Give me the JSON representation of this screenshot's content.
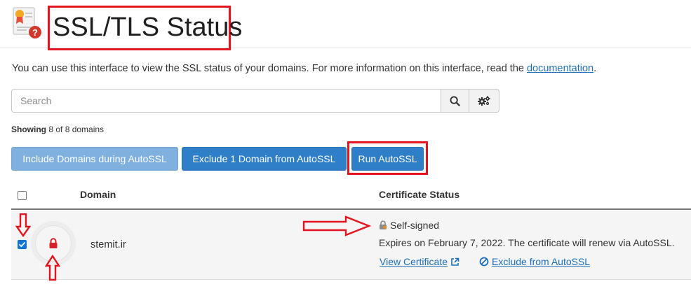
{
  "header": {
    "title": "SSL/TLS Status",
    "icon": "ssl-certificate-icon"
  },
  "intro": {
    "text": "You can use this interface to view the SSL status of your domains. For more information on this interface, read the ",
    "link": "documentation",
    "suffix": "."
  },
  "search": {
    "placeholder": "Search",
    "value": ""
  },
  "showing": {
    "label": "Showing",
    "text": "8 of 8 domains"
  },
  "actions": {
    "include": "Include Domains during AutoSSL",
    "exclude": "Exclude 1 Domain from AutoSSL",
    "run": "Run AutoSSL"
  },
  "table": {
    "columns": [
      "Domain",
      "Certificate Status"
    ],
    "rows": [
      {
        "checked": true,
        "domain": "stemit.ir",
        "status": "Self-signed",
        "detail": "Expires on February 7, 2022. The certificate will renew via AutoSSL.",
        "view_link": "View Certificate",
        "exclude_link": "Exclude from AutoSSL"
      }
    ]
  },
  "colors": {
    "accent": "#2f7fc8",
    "accent_light": "#7fb0de",
    "annotation_red": "#e3141e",
    "link": "#1e6fb8"
  }
}
